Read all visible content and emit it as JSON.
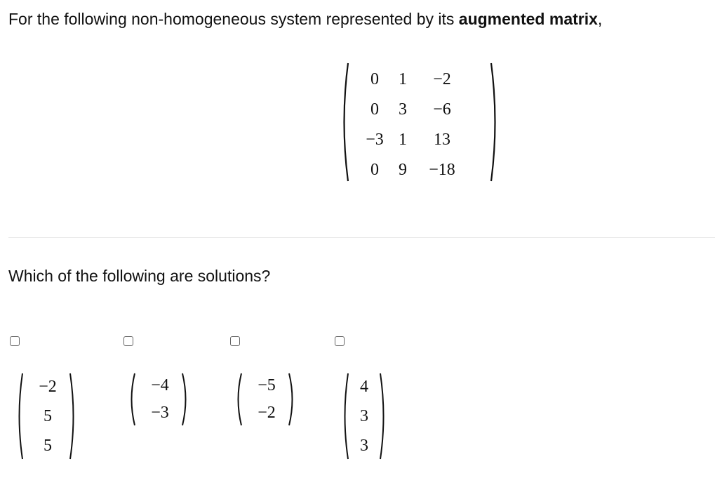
{
  "prompt": {
    "before": "For the following non-homogeneous system represented by its ",
    "bold": "augmented matrix",
    "after": ","
  },
  "matrix": {
    "rows": [
      [
        "0",
        "1",
        "−2"
      ],
      [
        "0",
        "3",
        "−6"
      ],
      [
        "−3",
        "1",
        "13"
      ],
      [
        "0",
        "9",
        "−18"
      ]
    ]
  },
  "question": "Which of the following are solutions?",
  "options": [
    {
      "values": [
        "−2",
        "5",
        "5"
      ]
    },
    {
      "values": [
        "−4",
        "−3"
      ]
    },
    {
      "values": [
        "−5",
        "−2"
      ]
    },
    {
      "values": [
        "4",
        "3",
        "3"
      ]
    }
  ]
}
